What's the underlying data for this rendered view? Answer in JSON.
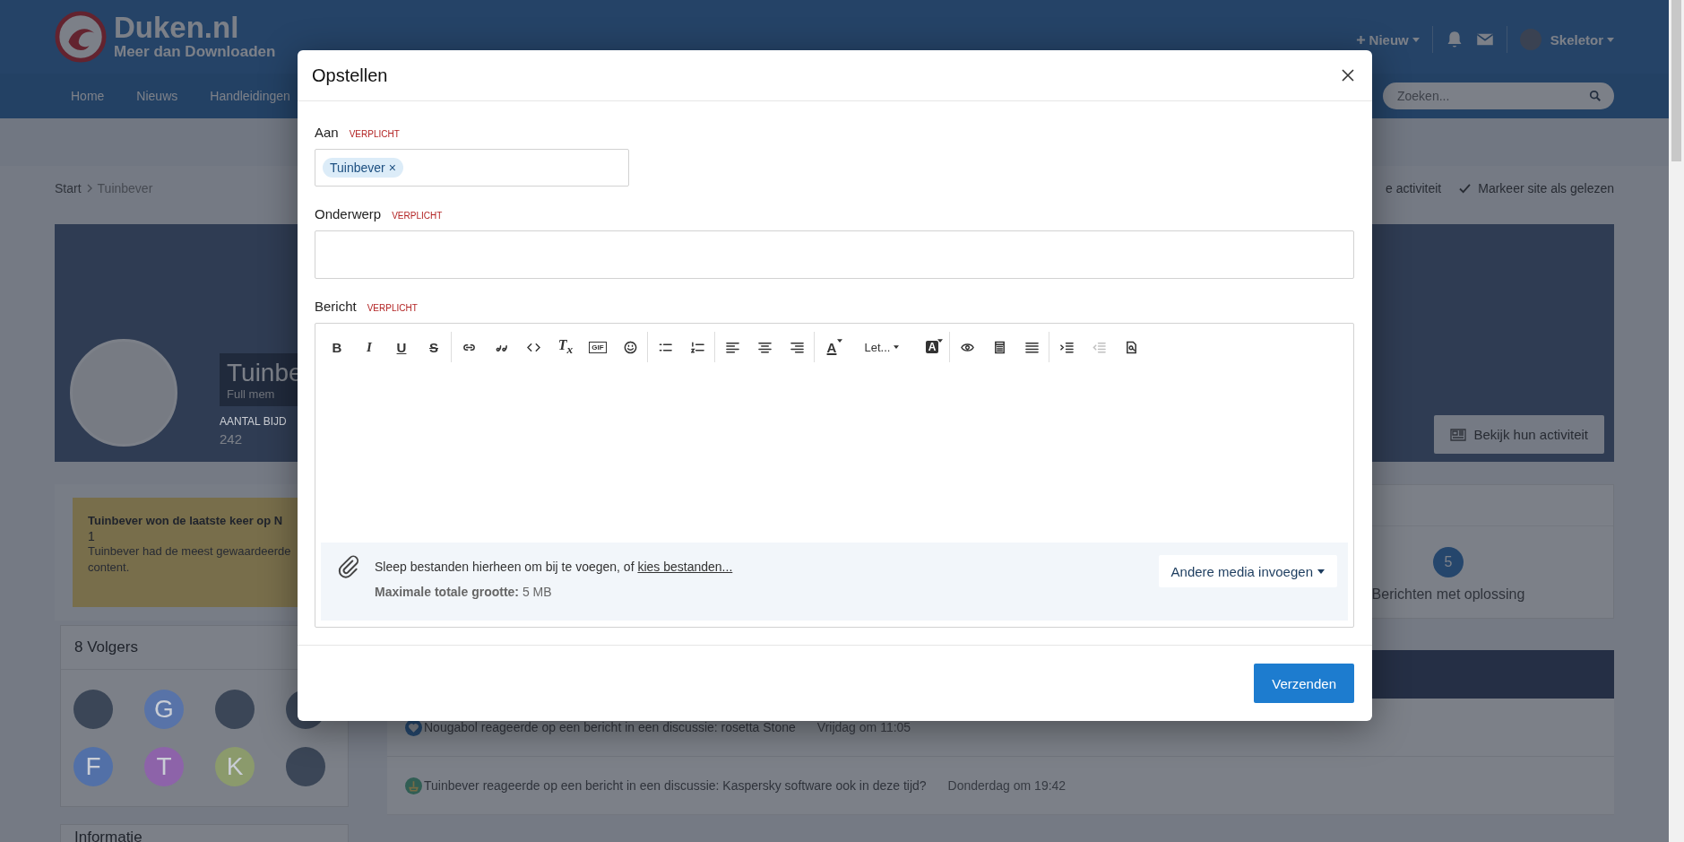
{
  "header": {
    "logo_title": "Duken.nl",
    "logo_tagline": "Meer dan Downloaden",
    "new_button": "Nieuw",
    "user": "Skeletor"
  },
  "nav": [
    "Home",
    "Nieuws",
    "Handleidingen"
  ],
  "search": {
    "placeholder": "Zoeken..."
  },
  "breadcrumb": [
    "Start",
    "Tuinbever"
  ],
  "page_actions": [
    "e activiteit",
    "Markeer site als gelezen"
  ],
  "profile": {
    "name": "Tuinbe",
    "group": "Full mem",
    "stat_label": "AANTAL BIJD",
    "stat_value": "242",
    "activity_button": "Bekijk hun activiteit"
  },
  "leaderboard_notice": {
    "title": "Tuinbever won de laatste keer op N",
    "count": "1",
    "text": "Tuinbever had de meest gewaardeerde content."
  },
  "followers": {
    "title": "8 Volgers",
    "avatars": [
      {
        "kind": "photo"
      },
      {
        "kind": "letter",
        "letter": "G",
        "color": "#5873a8"
      },
      {
        "kind": "photo"
      },
      {
        "kind": "photo"
      },
      {
        "kind": "letter",
        "letter": "F",
        "color": "#5270a7"
      },
      {
        "kind": "letter",
        "letter": "T",
        "color": "#8d63a9"
      },
      {
        "kind": "letter",
        "letter": "K",
        "color": "#8b9a6c"
      },
      {
        "kind": "photo"
      }
    ]
  },
  "info_panel": {
    "title": "Informatie"
  },
  "stats": [
    {
      "value": "5",
      "label": "Berichten met oplossing"
    }
  ],
  "activity": [
    {
      "kind": "heart",
      "text": "Nougabol reageerde op een bericht in een discussie: rosetta Stone",
      "time": "Vrijdag om 11:05"
    },
    {
      "kind": "thanks",
      "text": "Tuinbever reageerde op een bericht in een discussie: Kaspersky software ook in deze tijd?",
      "time": "Donderdag om 19:42"
    }
  ],
  "modal": {
    "title": "Opstellen",
    "fields": [
      {
        "kind": "recipients",
        "label": "Aan",
        "required": "VERPLICHT",
        "tokens": [
          {
            "label": "Tuinbever",
            "remove": "×"
          }
        ]
      },
      {
        "kind": "text",
        "label": "Onderwerp",
        "required": "VERPLICHT"
      },
      {
        "kind": "editor",
        "label": "Bericht",
        "required": "VERPLICHT"
      }
    ],
    "toolbar": [
      [
        {
          "kind": "bold",
          "label": "B",
          "disabled": false
        },
        {
          "kind": "italic",
          "label": "I",
          "disabled": false
        },
        {
          "kind": "underline",
          "label": "U",
          "disabled": false
        },
        {
          "kind": "strike",
          "label": "S",
          "disabled": false
        }
      ],
      [
        {
          "kind": "link",
          "disabled": false
        },
        {
          "kind": "quote",
          "disabled": false
        },
        {
          "kind": "code",
          "disabled": false
        },
        {
          "kind": "clear",
          "label": "T$_{x}$",
          "disabled": false
        },
        {
          "kind": "gif",
          "label": "GIF",
          "disabled": false
        },
        {
          "kind": "emoji",
          "disabled": false
        }
      ],
      [
        {
          "kind": "bullets",
          "disabled": false
        },
        {
          "kind": "numbers",
          "disabled": false
        }
      ],
      [
        {
          "kind": "align-left",
          "disabled": false
        },
        {
          "kind": "align-center",
          "disabled": false
        },
        {
          "kind": "align-right",
          "disabled": false
        }
      ],
      [
        {
          "kind": "text-color",
          "label": "A",
          "disabled": false
        },
        {
          "kind": "font",
          "label": "Let...",
          "disabled": false
        },
        {
          "kind": "background-color",
          "label": "A",
          "disabled": false
        }
      ],
      [
        {
          "kind": "preview",
          "disabled": false
        },
        {
          "kind": "template",
          "disabled": false
        },
        {
          "kind": "justify",
          "disabled": false
        }
      ],
      [
        {
          "kind": "indent",
          "disabled": false
        },
        {
          "kind": "outdent",
          "disabled": true
        },
        {
          "kind": "find",
          "disabled": false
        }
      ]
    ],
    "attachments": {
      "text": "Sleep bestanden hierheen om bij te voegen, of ",
      "link": "kies bestanden...",
      "limit_label": "Maximale totale grootte:",
      "limit_value": "5 MB",
      "media_button": "Andere media invoegen"
    },
    "submit": "Verzenden"
  }
}
